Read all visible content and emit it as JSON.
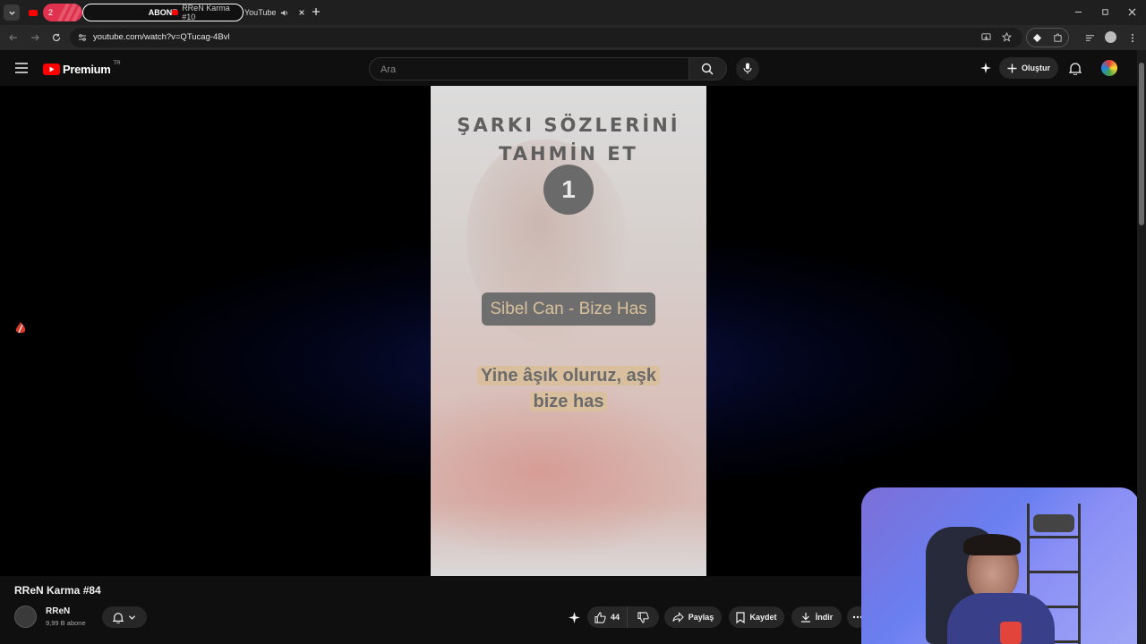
{
  "browser": {
    "tabs": [
      {
        "label": "2",
        "active": false
      },
      {
        "label": "ABONE",
        "active": true
      },
      {
        "label": "RReN Karma #10",
        "active": false
      },
      {
        "label": "YouTube",
        "active": false
      }
    ],
    "url": "youtube.com/watch?v=QTucag-4Bvl"
  },
  "youtube": {
    "logo_text": "Premium",
    "region": "TR",
    "search_placeholder": "Ara",
    "create_label": "Oluştur"
  },
  "video_overlay": {
    "title_line1": "ŞARKI SÖZLERİNİ",
    "title_line2": "TAHMİN ET",
    "number": "1",
    "song": "Sibel Can - Bize Has",
    "lyric_line1": "Yine âşık oluruz, aşk",
    "lyric_line2": "bize has"
  },
  "video_info": {
    "title": "RReN Karma #84",
    "channel_name": "RReN",
    "subscribers": "9,99 B abone",
    "likes": "44",
    "share_label": "Paylaş",
    "save_label": "Kaydet",
    "download_label": "İndir"
  },
  "colors": {
    "accent": "#ff0000",
    "background": "#0f0f0f",
    "pill": "#272727"
  }
}
